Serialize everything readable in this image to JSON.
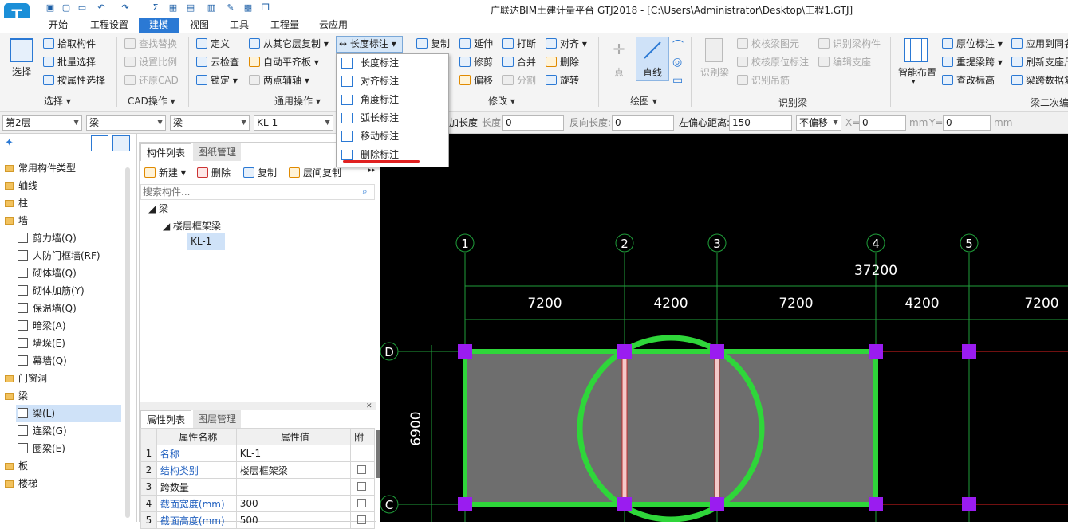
{
  "window": {
    "title": "广联达BIM土建计量平台 GTJ2018 - [C:\\Users\\Administrator\\Desktop\\工程1.GTJ]"
  },
  "menu": {
    "tabs": [
      "开始",
      "工程设置",
      "建模",
      "视图",
      "工具",
      "工程量",
      "云应用"
    ],
    "active": "建模"
  },
  "ribbon": {
    "select": {
      "big": "选择",
      "items": [
        "拾取构件",
        "批量选择",
        "按属性选择"
      ],
      "group": "选择"
    },
    "cad": {
      "items": [
        "查找替换",
        "设置比例",
        "还原CAD"
      ],
      "group": "CAD操作"
    },
    "common": {
      "col1": [
        "定义",
        "云检查",
        "锁定"
      ],
      "col2": [
        "从其它层复制",
        "自动平齐板",
        "两点辅轴"
      ],
      "group": "通用操作"
    },
    "dim": {
      "label": "长度标注"
    },
    "modify": {
      "col1": [
        "复制"
      ],
      "col2": [
        "延伸",
        "修剪",
        "偏移"
      ],
      "col3": [
        "打断",
        "合并",
        "分割"
      ],
      "col4": [
        "对齐",
        "删除",
        "旋转"
      ],
      "group": "修改"
    },
    "draw": {
      "point": "点",
      "line": "直线",
      "group": "绘图"
    },
    "recog": {
      "big": "识别梁",
      "col1": [
        "校核梁图元",
        "校核原位标注",
        "识别吊筋"
      ],
      "col2": [
        "识别梁构件",
        "编辑支座"
      ],
      "group": "识别梁"
    },
    "second": {
      "big": "智能布置",
      "col1": [
        "原位标注",
        "重提梁跨",
        "查改标高"
      ],
      "col2": [
        "应用到同名",
        "刷新支座尺",
        "梁跨数据复"
      ],
      "group": "梁二次编"
    }
  },
  "dropdown": {
    "items": [
      "长度标注",
      "对齐标注",
      "角度标注",
      "弧长标注",
      "移动标注",
      "删除标注"
    ]
  },
  "propbar": {
    "floor": "第2层",
    "type": "梁",
    "subtype": "梁",
    "member": "KL-1",
    "extend_label": "加长度",
    "length_label": "长度:",
    "length_value": "0",
    "rev_label": "反向长度:",
    "rev_value": "0",
    "offset_label": "左偏心距离:",
    "offset_value": "150",
    "nooffset": "不偏移",
    "x_label": "X=",
    "x_value": "0",
    "y_label": "Y=",
    "y_value": "0",
    "unit": "mm"
  },
  "tree": {
    "items": [
      {
        "label": "常用构件类型",
        "level": 0,
        "kind": "folder"
      },
      {
        "label": "轴线",
        "level": 0,
        "kind": "folder"
      },
      {
        "label": "柱",
        "level": 0,
        "kind": "folder"
      },
      {
        "label": "墙",
        "level": 0,
        "kind": "folder"
      },
      {
        "label": "剪力墙(Q)",
        "level": 1,
        "kind": "item"
      },
      {
        "label": "人防门框墙(RF)",
        "level": 1,
        "kind": "item"
      },
      {
        "label": "砌体墙(Q)",
        "level": 1,
        "kind": "item"
      },
      {
        "label": "砌体加筋(Y)",
        "level": 1,
        "kind": "item"
      },
      {
        "label": "保温墙(Q)",
        "level": 1,
        "kind": "item"
      },
      {
        "label": "暗梁(A)",
        "level": 1,
        "kind": "item"
      },
      {
        "label": "墙垛(E)",
        "level": 1,
        "kind": "item"
      },
      {
        "label": "幕墙(Q)",
        "level": 1,
        "kind": "item"
      },
      {
        "label": "门窗洞",
        "level": 0,
        "kind": "folder"
      },
      {
        "label": "梁",
        "level": 0,
        "kind": "folder"
      },
      {
        "label": "梁(L)",
        "level": 1,
        "kind": "item",
        "selected": true
      },
      {
        "label": "连梁(G)",
        "level": 1,
        "kind": "item"
      },
      {
        "label": "圈梁(E)",
        "level": 1,
        "kind": "item"
      },
      {
        "label": "板",
        "level": 0,
        "kind": "folder"
      },
      {
        "label": "楼梯",
        "level": 0,
        "kind": "folder"
      }
    ]
  },
  "members": {
    "tabs": [
      "构件列表",
      "图纸管理"
    ],
    "new": "新建",
    "delete": "删除",
    "copy": "复制",
    "floorcopy": "层间复制",
    "search_placeholder": "搜索构件...",
    "root": "梁",
    "group": "楼层框架梁",
    "item": "KL-1"
  },
  "properties": {
    "tabs": [
      "属性列表",
      "图层管理"
    ],
    "headers": [
      "属性名称",
      "属性值",
      "附"
    ],
    "rows": [
      {
        "n": "1",
        "name": "名称",
        "value": "KL-1"
      },
      {
        "n": "2",
        "name": "结构类别",
        "value": "楼层框架梁"
      },
      {
        "n": "3",
        "name": "跨数量",
        "value": ""
      },
      {
        "n": "4",
        "name": "截面宽度(mm)",
        "value": "300"
      },
      {
        "n": "5",
        "name": "截面高度(mm)",
        "value": "500"
      }
    ]
  },
  "drawing": {
    "axes": [
      "1",
      "2",
      "3",
      "4",
      "5"
    ],
    "rows": [
      "D",
      "C"
    ],
    "total": "37200",
    "spans": [
      "7200",
      "4200",
      "7200",
      "4200",
      "7200"
    ],
    "vspan": "6900"
  }
}
